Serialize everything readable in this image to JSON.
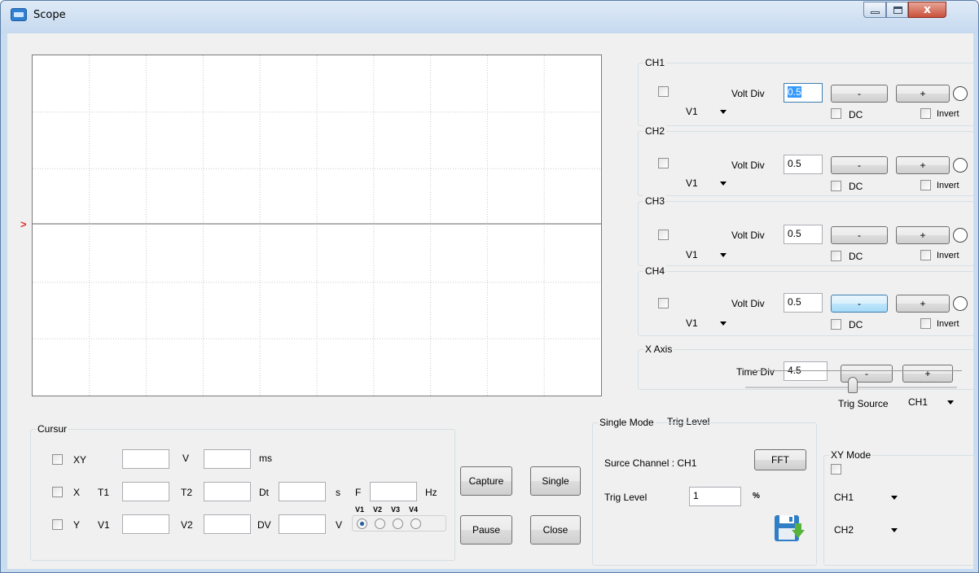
{
  "window": {
    "title": "Scope",
    "close_glyph": "x"
  },
  "scope_display": {
    "trigger_marker": ">"
  },
  "channels": [
    {
      "group": "CH1",
      "source": "V1",
      "volt_div_label": "Volt Div",
      "volt_div": "0.5",
      "minus": "-",
      "plus": "+",
      "dc": "DC",
      "invert": "Invert"
    },
    {
      "group": "CH2",
      "source": "V1",
      "volt_div_label": "Volt Div",
      "volt_div": "0.5",
      "minus": "-",
      "plus": "+",
      "dc": "DC",
      "invert": "Invert"
    },
    {
      "group": "CH3",
      "source": "V1",
      "volt_div_label": "Volt Div",
      "volt_div": "0.5",
      "minus": "-",
      "plus": "+",
      "dc": "DC",
      "invert": "Invert"
    },
    {
      "group": "CH4",
      "source": "V1",
      "volt_div_label": "Volt Div",
      "volt_div": "0.5",
      "minus": "-",
      "plus": "+",
      "dc": "DC",
      "invert": "Invert"
    }
  ],
  "x_axis": {
    "group": "X Axis",
    "time_div_label": "Time Div",
    "time_div": "4.5",
    "minus": "-",
    "plus": "+"
  },
  "trigger": {
    "level_label": "Trig Level",
    "source_label": "Trig Source",
    "source": "CH1"
  },
  "cursor": {
    "group": "Cursur",
    "xy": {
      "label": "XY",
      "v": "V",
      "ms": "ms"
    },
    "x": {
      "label": "X",
      "t1": "T1",
      "t2": "T2",
      "dt": "Dt",
      "s": "s",
      "f": "F",
      "hz": "Hz"
    },
    "y": {
      "label": "Y",
      "v1": "V1",
      "v2": "V2",
      "dv": "DV",
      "v": "V"
    },
    "radio_labels": [
      "V1",
      "V2",
      "V3",
      "V4"
    ],
    "radio_selected": "V1"
  },
  "buttons": {
    "capture": "Capture",
    "single": "Single",
    "pause": "Pause",
    "close": "Close"
  },
  "single_mode": {
    "group": "Single Mode",
    "source_channel": "Surce Channel : CH1",
    "fft": "FFT",
    "trig_level_label": "Trig Level",
    "trig_level": "1",
    "percent": "%"
  },
  "xy_mode": {
    "group": "XY Mode",
    "ch_a": "CH1",
    "ch_b": "CH2"
  }
}
